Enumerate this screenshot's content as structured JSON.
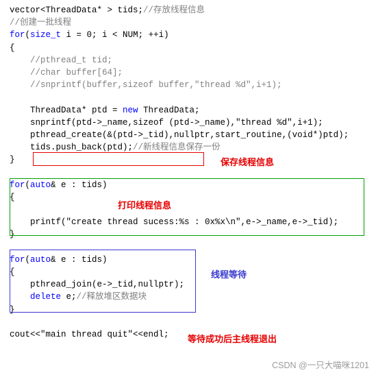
{
  "code": {
    "lines": [
      [
        {
          "t": "vector<ThreadData* > tids;",
          "c": "plain"
        },
        {
          "t": "//存放线程信息",
          "c": "cmt"
        }
      ],
      [
        {
          "t": "//创建一批线程",
          "c": "cmt"
        }
      ],
      [
        {
          "t": "for",
          "c": "kw"
        },
        {
          "t": "(",
          "c": "plain"
        },
        {
          "t": "size_t",
          "c": "kw"
        },
        {
          "t": " i = 0; i < NUM; ++i)",
          "c": "plain"
        }
      ],
      [
        {
          "t": "{",
          "c": "plain"
        }
      ],
      [
        {
          "t": "    //pthread_t tid;",
          "c": "cmt"
        }
      ],
      [
        {
          "t": "    //char buffer[64];",
          "c": "cmt"
        }
      ],
      [
        {
          "t": "    //snprintf(buffer,sizeof buffer,\"thread %d\",i+1);",
          "c": "cmt"
        }
      ],
      [
        {
          "t": "",
          "c": "plain"
        }
      ],
      [
        {
          "t": "    ThreadData* ptd = ",
          "c": "plain"
        },
        {
          "t": "new",
          "c": "kw"
        },
        {
          "t": " ThreadData;",
          "c": "plain"
        }
      ],
      [
        {
          "t": "    snprintf(ptd->_name,sizeof (ptd->_name),\"thread %d\",i+1);",
          "c": "plain"
        }
      ],
      [
        {
          "t": "    pthread_create(&(ptd->_tid),nullptr,start_routine,(void*)ptd);",
          "c": "plain"
        }
      ],
      [
        {
          "t": "    tids.push_back(ptd);",
          "c": "plain"
        },
        {
          "t": "//新线程信息保存一份",
          "c": "cmt"
        }
      ],
      [
        {
          "t": "}",
          "c": "plain"
        }
      ],
      [
        {
          "t": "",
          "c": "plain"
        }
      ],
      [
        {
          "t": "for",
          "c": "kw"
        },
        {
          "t": "(",
          "c": "plain"
        },
        {
          "t": "auto",
          "c": "kw"
        },
        {
          "t": "& e : tids)",
          "c": "plain"
        }
      ],
      [
        {
          "t": "{",
          "c": "plain"
        }
      ],
      [
        {
          "t": "",
          "c": "plain"
        }
      ],
      [
        {
          "t": "    printf(\"create thread sucess:%s : 0x%x\\n\",e->_name,e->_tid);",
          "c": "plain"
        }
      ],
      [
        {
          "t": "}",
          "c": "plain"
        }
      ],
      [
        {
          "t": "",
          "c": "plain"
        }
      ],
      [
        {
          "t": "for",
          "c": "kw"
        },
        {
          "t": "(",
          "c": "plain"
        },
        {
          "t": "auto",
          "c": "kw"
        },
        {
          "t": "& e : tids)",
          "c": "plain"
        }
      ],
      [
        {
          "t": "{",
          "c": "plain"
        }
      ],
      [
        {
          "t": "    pthread_join(e->_tid,nullptr);",
          "c": "plain"
        }
      ],
      [
        {
          "t": "    ",
          "c": "plain"
        },
        {
          "t": "delete",
          "c": "kw"
        },
        {
          "t": " e;",
          "c": "plain"
        },
        {
          "t": "//释放堆区数据块",
          "c": "cmt"
        }
      ],
      [
        {
          "t": "}",
          "c": "plain"
        }
      ],
      [
        {
          "t": "",
          "c": "plain"
        }
      ],
      [
        {
          "t": "cout<<\"main thread quit\"<<endl;",
          "c": "plain"
        }
      ]
    ]
  },
  "annotations": {
    "save_thread_info": "保存线程信息",
    "print_thread_info": "打印线程信息",
    "thread_wait": "线程等待",
    "main_exit": "等待成功后主线程退出"
  },
  "colors": {
    "red": "#e60000",
    "green": "#00a000",
    "blue": "#3a3ad0",
    "keyword": "#0000ff",
    "comment": "#808080"
  },
  "watermark": "CSDN @一只大喵咪1201"
}
